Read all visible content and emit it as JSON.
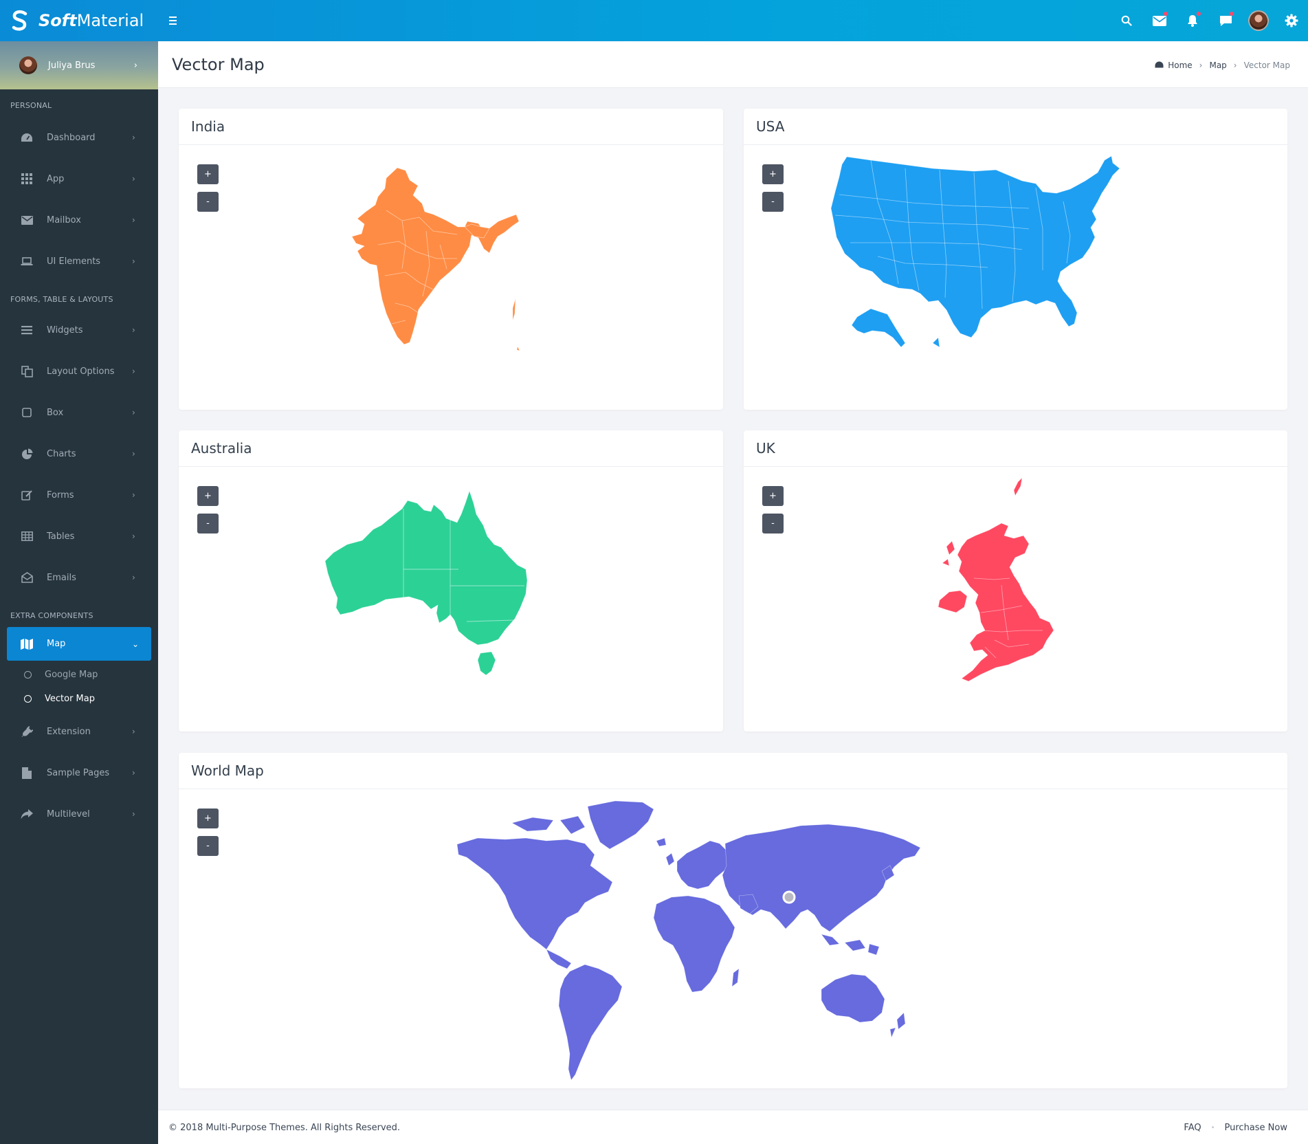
{
  "app": {
    "brand_bold": "Soft",
    "brand_rest": "Material"
  },
  "user": {
    "name": "Juliya Brus"
  },
  "sidebar": {
    "sections": [
      "PERSONAL",
      "FORMS, TABLE & LAYOUTS",
      "EXTRA COMPONENTS"
    ],
    "personal": [
      {
        "label": "Dashboard",
        "icon": "dashboard-icon"
      },
      {
        "label": "App",
        "icon": "grid-icon"
      },
      {
        "label": "Mailbox",
        "icon": "envelope-icon"
      },
      {
        "label": "UI Elements",
        "icon": "laptop-icon"
      }
    ],
    "forms": [
      {
        "label": "Widgets",
        "icon": "list-icon"
      },
      {
        "label": "Layout Options",
        "icon": "copy-icon"
      },
      {
        "label": "Box",
        "icon": "square-icon"
      },
      {
        "label": "Charts",
        "icon": "pie-chart-icon"
      },
      {
        "label": "Forms",
        "icon": "edit-icon"
      },
      {
        "label": "Tables",
        "icon": "table-icon"
      },
      {
        "label": "Emails",
        "icon": "envelope-open-icon"
      }
    ],
    "map": {
      "label": "Map",
      "icon": "map-icon"
    },
    "map_sub": [
      "Google Map",
      "Vector Map"
    ],
    "extra": [
      {
        "label": "Extension",
        "icon": "plug-icon"
      },
      {
        "label": "Sample Pages",
        "icon": "file-icon"
      },
      {
        "label": "Multilevel",
        "icon": "share-icon"
      }
    ]
  },
  "header": {
    "title": "Vector Map"
  },
  "breadcrumb": {
    "home": "Home",
    "section": "Map",
    "current": "Vector Map"
  },
  "maps": {
    "zoom_in": "+",
    "zoom_out": "-",
    "india": {
      "title": "India",
      "color": "#ff8c44"
    },
    "usa": {
      "title": "USA",
      "color": "#1e9ff2"
    },
    "australia": {
      "title": "Australia",
      "color": "#2cd196"
    },
    "uk": {
      "title": "UK",
      "color": "#ff4961"
    },
    "world": {
      "title": "World Map",
      "color": "#676bde"
    }
  },
  "footer": {
    "copyright": "© 2018 Multi-Purpose Themes. All Rights Reserved.",
    "faq": "FAQ",
    "purchase": "Purchase Now"
  },
  "colors": {
    "topbar": "#0a8bd6",
    "sidebar": "#26343d",
    "active": "#0b86d3"
  }
}
